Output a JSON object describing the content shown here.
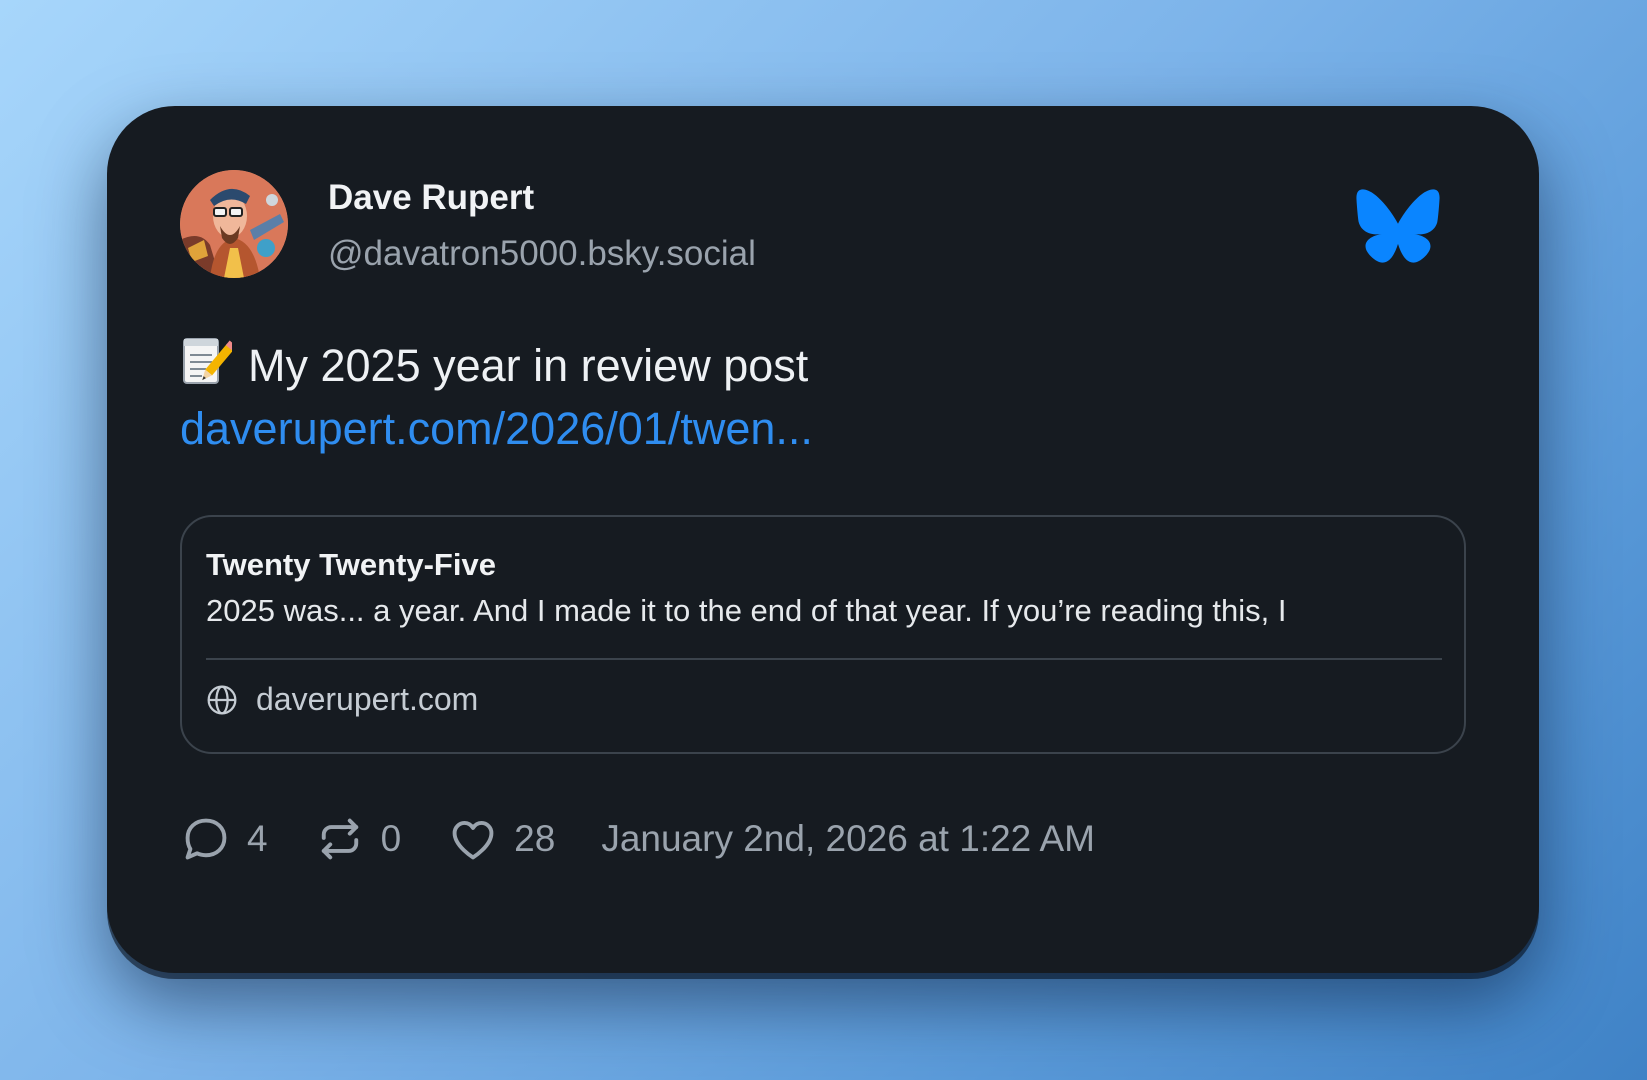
{
  "author": {
    "name": "Dave Rupert",
    "handle": "@davatron5000.bsky.social"
  },
  "post": {
    "emoji_icon": "memo-icon",
    "text": "My 2025 year in review post",
    "link_text": "daverupert.com/2026/01/twen..."
  },
  "embed": {
    "title": "Twenty Twenty-Five",
    "description": "2025 was... a year. And I made it to the end of that year. If you’re reading this, I",
    "domain": "daverupert.com"
  },
  "actions": {
    "replies": "4",
    "reposts": "0",
    "likes": "28"
  },
  "timestamp": "January 2nd, 2026 at 1:22 AM",
  "colors": {
    "card_background": "#161b21",
    "link": "#2f8df0",
    "bluesky_brand": "#0a85ff",
    "muted_text": "#9aa3ad"
  }
}
